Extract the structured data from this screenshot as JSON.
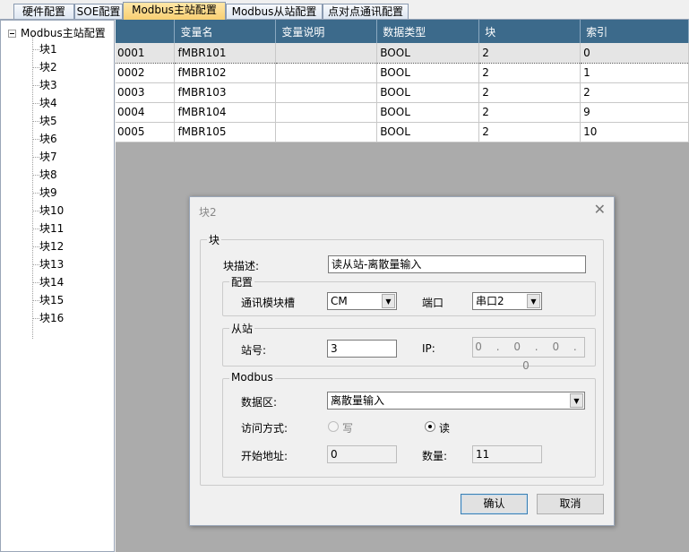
{
  "tabs": [
    {
      "label": "硬件配置"
    },
    {
      "label": "SOE配置"
    },
    {
      "label": "Modbus主站配置"
    },
    {
      "label": "Modbus从站配置"
    },
    {
      "label": "点对点通讯配置"
    }
  ],
  "tree": {
    "root": "Modbus主站配置",
    "items": [
      "块1",
      "块2",
      "块3",
      "块4",
      "块5",
      "块6",
      "块7",
      "块8",
      "块9",
      "块10",
      "块11",
      "块12",
      "块13",
      "块14",
      "块15",
      "块16"
    ]
  },
  "table": {
    "columns": [
      "",
      "变量名",
      "变量说明",
      "数据类型",
      "块",
      "索引"
    ],
    "rows": [
      [
        "0001",
        "fMBR101",
        "",
        "BOOL",
        "2",
        "0"
      ],
      [
        "0002",
        "fMBR102",
        "",
        "BOOL",
        "2",
        "1"
      ],
      [
        "0003",
        "fMBR103",
        "",
        "BOOL",
        "2",
        "2"
      ],
      [
        "0004",
        "fMBR104",
        "",
        "BOOL",
        "2",
        "9"
      ],
      [
        "0005",
        "fMBR105",
        "",
        "BOOL",
        "2",
        "10"
      ]
    ]
  },
  "dialog": {
    "title": "块2",
    "close_icon": "close-icon",
    "group_block": "块",
    "block_desc_label": "块描述:",
    "block_desc_value": "读从站-离散量输入",
    "group_config": "配置",
    "module_slot_label": "通讯模块槽",
    "module_slot_value": "CM",
    "port_label": "端口",
    "port_value": "串口2",
    "group_slave": "从站",
    "station_label": "站号:",
    "station_value": "3",
    "ip_label": "IP:",
    "ip_value": "0 . 0 . 0 . 0",
    "group_modbus": "Modbus",
    "data_area_label": "数据区:",
    "data_area_value": "离散量输入",
    "access_label": "访问方式:",
    "access_write": "写",
    "access_read": "读",
    "start_addr_label": "开始地址:",
    "start_addr_value": "0",
    "count_label": "数量:",
    "count_value": "11",
    "ok": "确认",
    "cancel": "取消"
  }
}
